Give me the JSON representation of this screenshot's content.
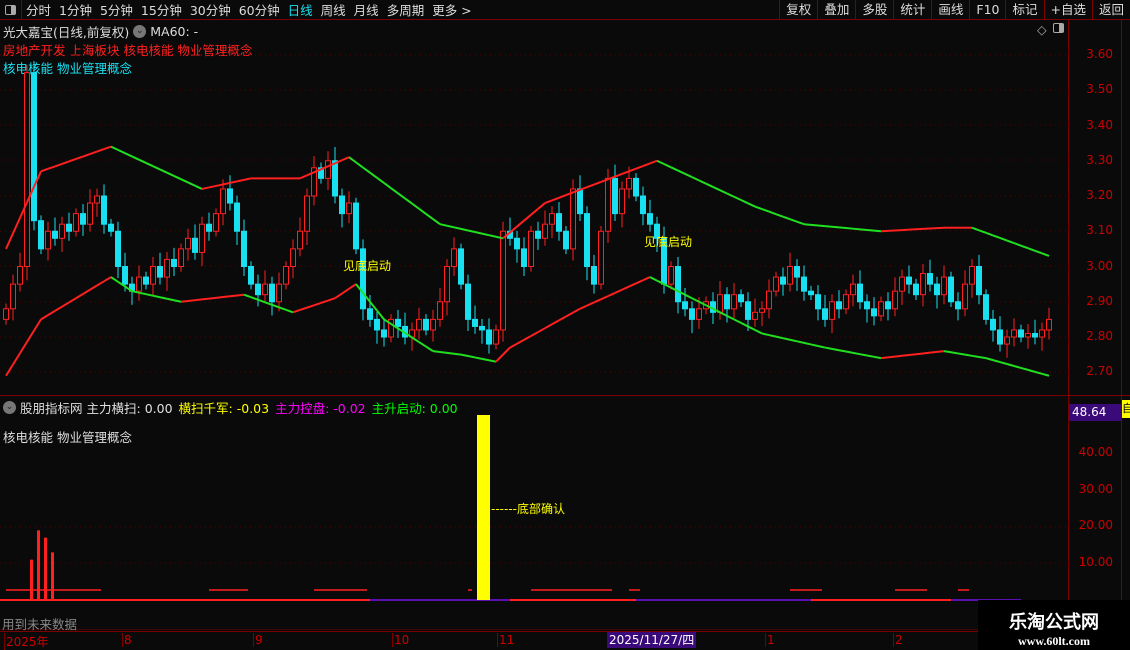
{
  "toolbar": {
    "periods": [
      "分时",
      "1分钟",
      "5分钟",
      "15分钟",
      "30分钟",
      "60分钟",
      "日线",
      "周线",
      "月线",
      "多周期",
      "更多 >"
    ],
    "active_period": "日线",
    "actions": [
      "复权",
      "叠加",
      "多股",
      "统计",
      "画线",
      "F10",
      "标记",
      "+自选",
      "返回"
    ]
  },
  "main_panel": {
    "title": "光大嘉宝(日线,前复权)",
    "ma_label": "MA60: -",
    "concept_red": "房地产开发 上海板块 核电核能 物业管理概念",
    "concept_cyan": "核电核能 物业管理概念",
    "signal_label": "见底启动",
    "price_ticks": [
      "3.60",
      "3.50",
      "3.40",
      "3.30",
      "3.20",
      "3.10",
      "3.00",
      "2.90",
      "2.80",
      "2.70"
    ]
  },
  "indicator_panel": {
    "name": "股朋指标网",
    "items": [
      {
        "label": "主力横扫: 0.00",
        "color": "#e0e0e0"
      },
      {
        "label": "横扫千军: -0.03",
        "color": "#ffff00"
      },
      {
        "label": "主力控盘: -0.02",
        "color": "#ff00ff"
      },
      {
        "label": "主升启动: 0.00",
        "color": "#00ff00"
      }
    ],
    "concept": "核电核能 物业管理概念",
    "annotation": "------底部确认",
    "current_value": "48.64",
    "ticks": [
      "40.00",
      "30.00",
      "20.00",
      "10.00"
    ],
    "footer": "用到未来数据"
  },
  "time_axis": {
    "labels": [
      "2025年",
      "8",
      "9",
      "10",
      "11",
      "1",
      "2"
    ],
    "cursor_date": "2025/11/27/四"
  },
  "watermark": {
    "name": "乐淘公式网",
    "url": "www.60lt.com"
  },
  "right_tabs_highlight": "自",
  "colors": {
    "up": "#ff2020",
    "down": "#18e0f0",
    "band_up": "#ff2020",
    "band_down": "#20e020",
    "signal": "#ffff00",
    "axis": "#7a0000"
  },
  "candle_closes": [
    2.88,
    2.95,
    3.0,
    3.55,
    3.13,
    3.05,
    3.1,
    3.08,
    3.12,
    3.1,
    3.15,
    3.12,
    3.18,
    3.2,
    3.12,
    3.1,
    3.0,
    2.95,
    2.93,
    2.97,
    2.95,
    3.0,
    2.97,
    3.02,
    3.0,
    3.05,
    3.08,
    3.04,
    3.12,
    3.1,
    3.15,
    3.22,
    3.18,
    3.1,
    3.0,
    2.95,
    2.92,
    2.95,
    2.9,
    2.95,
    3.0,
    3.05,
    3.1,
    3.2,
    3.28,
    3.25,
    3.3,
    3.2,
    3.15,
    3.18,
    3.05,
    2.88,
    2.85,
    2.82,
    2.8,
    2.85,
    2.83,
    2.8,
    2.82,
    2.85,
    2.82,
    2.85,
    2.9,
    3.0,
    3.05,
    2.95,
    2.85,
    2.83,
    2.82,
    2.78,
    2.82,
    3.1,
    3.08,
    3.05,
    3.0,
    3.1,
    3.08,
    3.12,
    3.15,
    3.1,
    3.05,
    3.22,
    3.15,
    3.0,
    2.95,
    3.1,
    3.25,
    3.15,
    3.22,
    3.25,
    3.2,
    3.15,
    3.12,
    3.08,
    2.95,
    3.0,
    2.9,
    2.88,
    2.85,
    2.88,
    2.9,
    2.87,
    2.92,
    2.88,
    2.92,
    2.9,
    2.85,
    2.87,
    2.88,
    2.93,
    2.97,
    2.95,
    3.0,
    2.97,
    2.93,
    2.92,
    2.88,
    2.85,
    2.9,
    2.88,
    2.92,
    2.95,
    2.9,
    2.88,
    2.86,
    2.9,
    2.88,
    2.93,
    2.97,
    2.95,
    2.92,
    2.98,
    2.95,
    2.92,
    2.97,
    2.9,
    2.88,
    2.95,
    3.0,
    2.92,
    2.85,
    2.82,
    2.78,
    2.8,
    2.82,
    2.8,
    2.81,
    2.8,
    2.82,
    2.85
  ],
  "upper_band": [
    [
      0,
      3.05
    ],
    [
      5,
      3.27
    ],
    [
      15,
      3.34
    ],
    [
      28,
      3.22
    ],
    [
      35,
      3.25
    ],
    [
      42,
      3.25
    ],
    [
      49,
      3.31
    ],
    [
      62,
      3.12
    ],
    [
      71,
      3.08
    ],
    [
      77,
      3.18
    ],
    [
      93,
      3.3
    ],
    [
      107,
      3.17
    ],
    [
      114,
      3.12
    ],
    [
      125,
      3.1
    ],
    [
      134,
      3.11
    ],
    [
      138,
      3.11
    ],
    [
      149,
      3.03
    ]
  ],
  "lower_band": [
    [
      0,
      2.69
    ],
    [
      5,
      2.85
    ],
    [
      15,
      2.97
    ],
    [
      18,
      2.93
    ],
    [
      25,
      2.9
    ],
    [
      34,
      2.92
    ],
    [
      41,
      2.87
    ],
    [
      47,
      2.91
    ],
    [
      50,
      2.95
    ],
    [
      54,
      2.85
    ],
    [
      61,
      2.76
    ],
    [
      65,
      2.75
    ],
    [
      70,
      2.73
    ],
    [
      72,
      2.77
    ],
    [
      82,
      2.88
    ],
    [
      92,
      2.97
    ],
    [
      99,
      2.9
    ],
    [
      108,
      2.81
    ],
    [
      117,
      2.77
    ],
    [
      125,
      2.74
    ],
    [
      134,
      2.76
    ],
    [
      140,
      2.74
    ],
    [
      149,
      2.69
    ]
  ],
  "signals": [
    49,
    92
  ],
  "indicator_bars": [
    [
      2,
      11
    ],
    [
      3,
      19
    ],
    [
      4,
      17
    ],
    [
      5,
      13
    ]
  ],
  "bottom_signal": [
    68,
    51
  ],
  "low_segments": [
    [
      0,
      13
    ],
    [
      29,
      34
    ],
    [
      44,
      51
    ],
    [
      66,
      66
    ],
    [
      75,
      86
    ],
    [
      89,
      90
    ],
    [
      112,
      116
    ],
    [
      127,
      131
    ],
    [
      136,
      137
    ]
  ]
}
